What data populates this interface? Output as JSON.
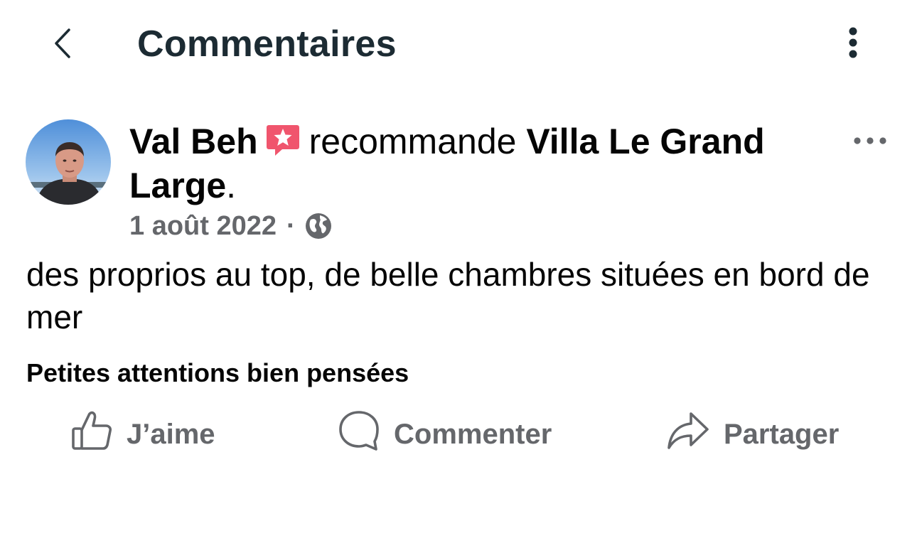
{
  "header": {
    "title": "Commentaires",
    "back_icon": "chevron-left-icon",
    "menu_icon": "vertical-dots-icon"
  },
  "post": {
    "author": "Val Beh",
    "badge_icon": "recommend-star-icon",
    "verb": "recommande",
    "page_name": "Villa Le Grand Large",
    "punct": ".",
    "date": "1 août 2022",
    "separator": "·",
    "privacy_icon": "globe-icon",
    "more_icon": "horizontal-dots-icon",
    "text": "des proprios au top, de belle chambres situées en bord de mer",
    "tag": "Petites attentions bien pensées"
  },
  "actions": {
    "like": "J’aime",
    "comment": "Commenter",
    "share": "Partager"
  },
  "colors": {
    "title": "#1c2b33",
    "text": "#050505",
    "muted": "#65676b",
    "badge": "#f0556d"
  }
}
